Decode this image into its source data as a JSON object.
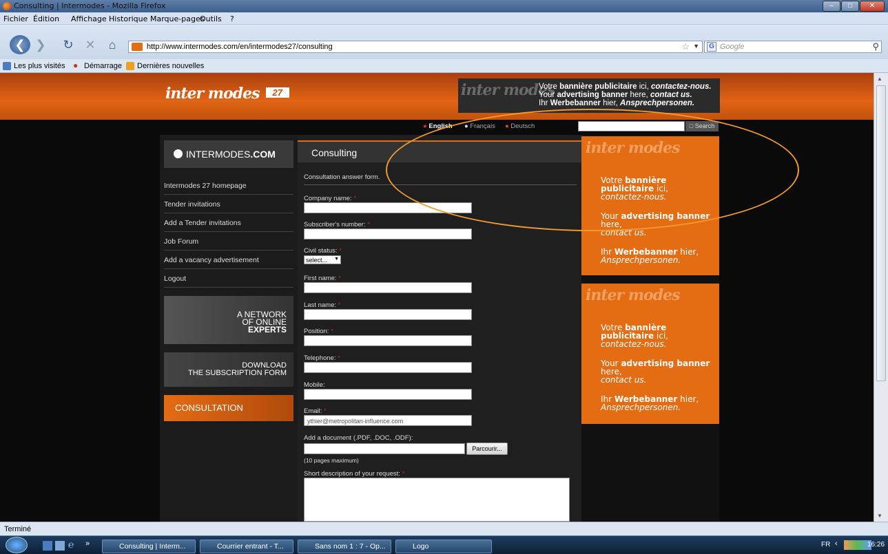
{
  "window": {
    "title": "Consulting | Intermodes - Mozilla Firefox"
  },
  "menu": [
    "Fichier",
    "Édition",
    "Affichage",
    "Historique",
    "Marque-pages",
    "Outils",
    "?"
  ],
  "nav": {
    "url": "http://www.intermodes.com/en/intermodes27/consulting",
    "search_placeholder": "Google"
  },
  "bookmarks": [
    "Les plus visités",
    "Démarrage",
    "Dernières nouvelles"
  ],
  "site": {
    "logo": "inter modes",
    "logo_badge": "27",
    "banner_logo": "inter modes",
    "banner_lines": [
      {
        "pre": "Votre ",
        "bold": "bannière publicitaire",
        "mid": " ici, ",
        "ital": "contactez-nous."
      },
      {
        "pre": "Your ",
        "bold": "advertising banner",
        "mid": " here, ",
        "ital": "contact us."
      },
      {
        "pre": "Ihr ",
        "bold": "Werbebanner",
        "mid": " hier, ",
        "ital": "Ansprechpersonen."
      }
    ],
    "languages": [
      "English",
      "Français",
      "Deutsch"
    ],
    "search_button": "Search",
    "side_logo_prefix": "INTERMODES",
    "side_logo_suffix": ".COM",
    "nav_links": [
      "Intermodes 27 homepage",
      "Tender invitations",
      "Add a Tender invitations",
      "Job Forum",
      "Add a vacancy advertisement",
      "Logout"
    ],
    "promo1": [
      "A NETWORK",
      "OF ONLINE",
      "EXPERTS"
    ],
    "promo2": [
      "DOWNLOAD",
      "THE SUBSCRIPTION FORM"
    ],
    "promo3": "CONSULTATION",
    "page_title": "Consulting",
    "form_intro": "Consultation answer form.",
    "form": {
      "company": "Company name:",
      "subscriber": "Subscriber's number:",
      "civil": "Civil status:",
      "civil_value": "select...",
      "first": "First name:",
      "last": "Last name:",
      "position": "Position:",
      "telephone": "Telephone:",
      "mobile": "Mobile:",
      "email": "Email:",
      "email_value": "ythier@metropolitan-influence.com",
      "document": "Add a document (.PDF, .DOC, .ODF):",
      "browse": "Parcourir...",
      "pages_note": "(10 pages maximum)",
      "description": "Short description of your request:",
      "required_mark": "*"
    },
    "ad": {
      "logo": "inter modes",
      "fr_pre": "Votre ",
      "fr_bold": "bannière publicitaire",
      "fr_mid": " ici,",
      "fr_ital": "contactez-nous.",
      "en_pre": "Your ",
      "en_bold": "advertising banner",
      "en_mid": " here,",
      "en_ital": "contact us.",
      "de_pre": "Ihr ",
      "de_bold": "Werbebanner",
      "de_mid": " hier,",
      "de_ital": "Ansprechpersonen."
    }
  },
  "status": "Terminé",
  "taskbar": {
    "tasks": [
      "Consulting | Interm...",
      "Courrier entrant - T...",
      "Sans nom 1 : 7 - Op...",
      "Logo"
    ],
    "lang": "FR",
    "time": "16:26"
  },
  "colors": {
    "accent": "#e46c13",
    "required": "#d62020",
    "highlight": "#f29a2e"
  }
}
